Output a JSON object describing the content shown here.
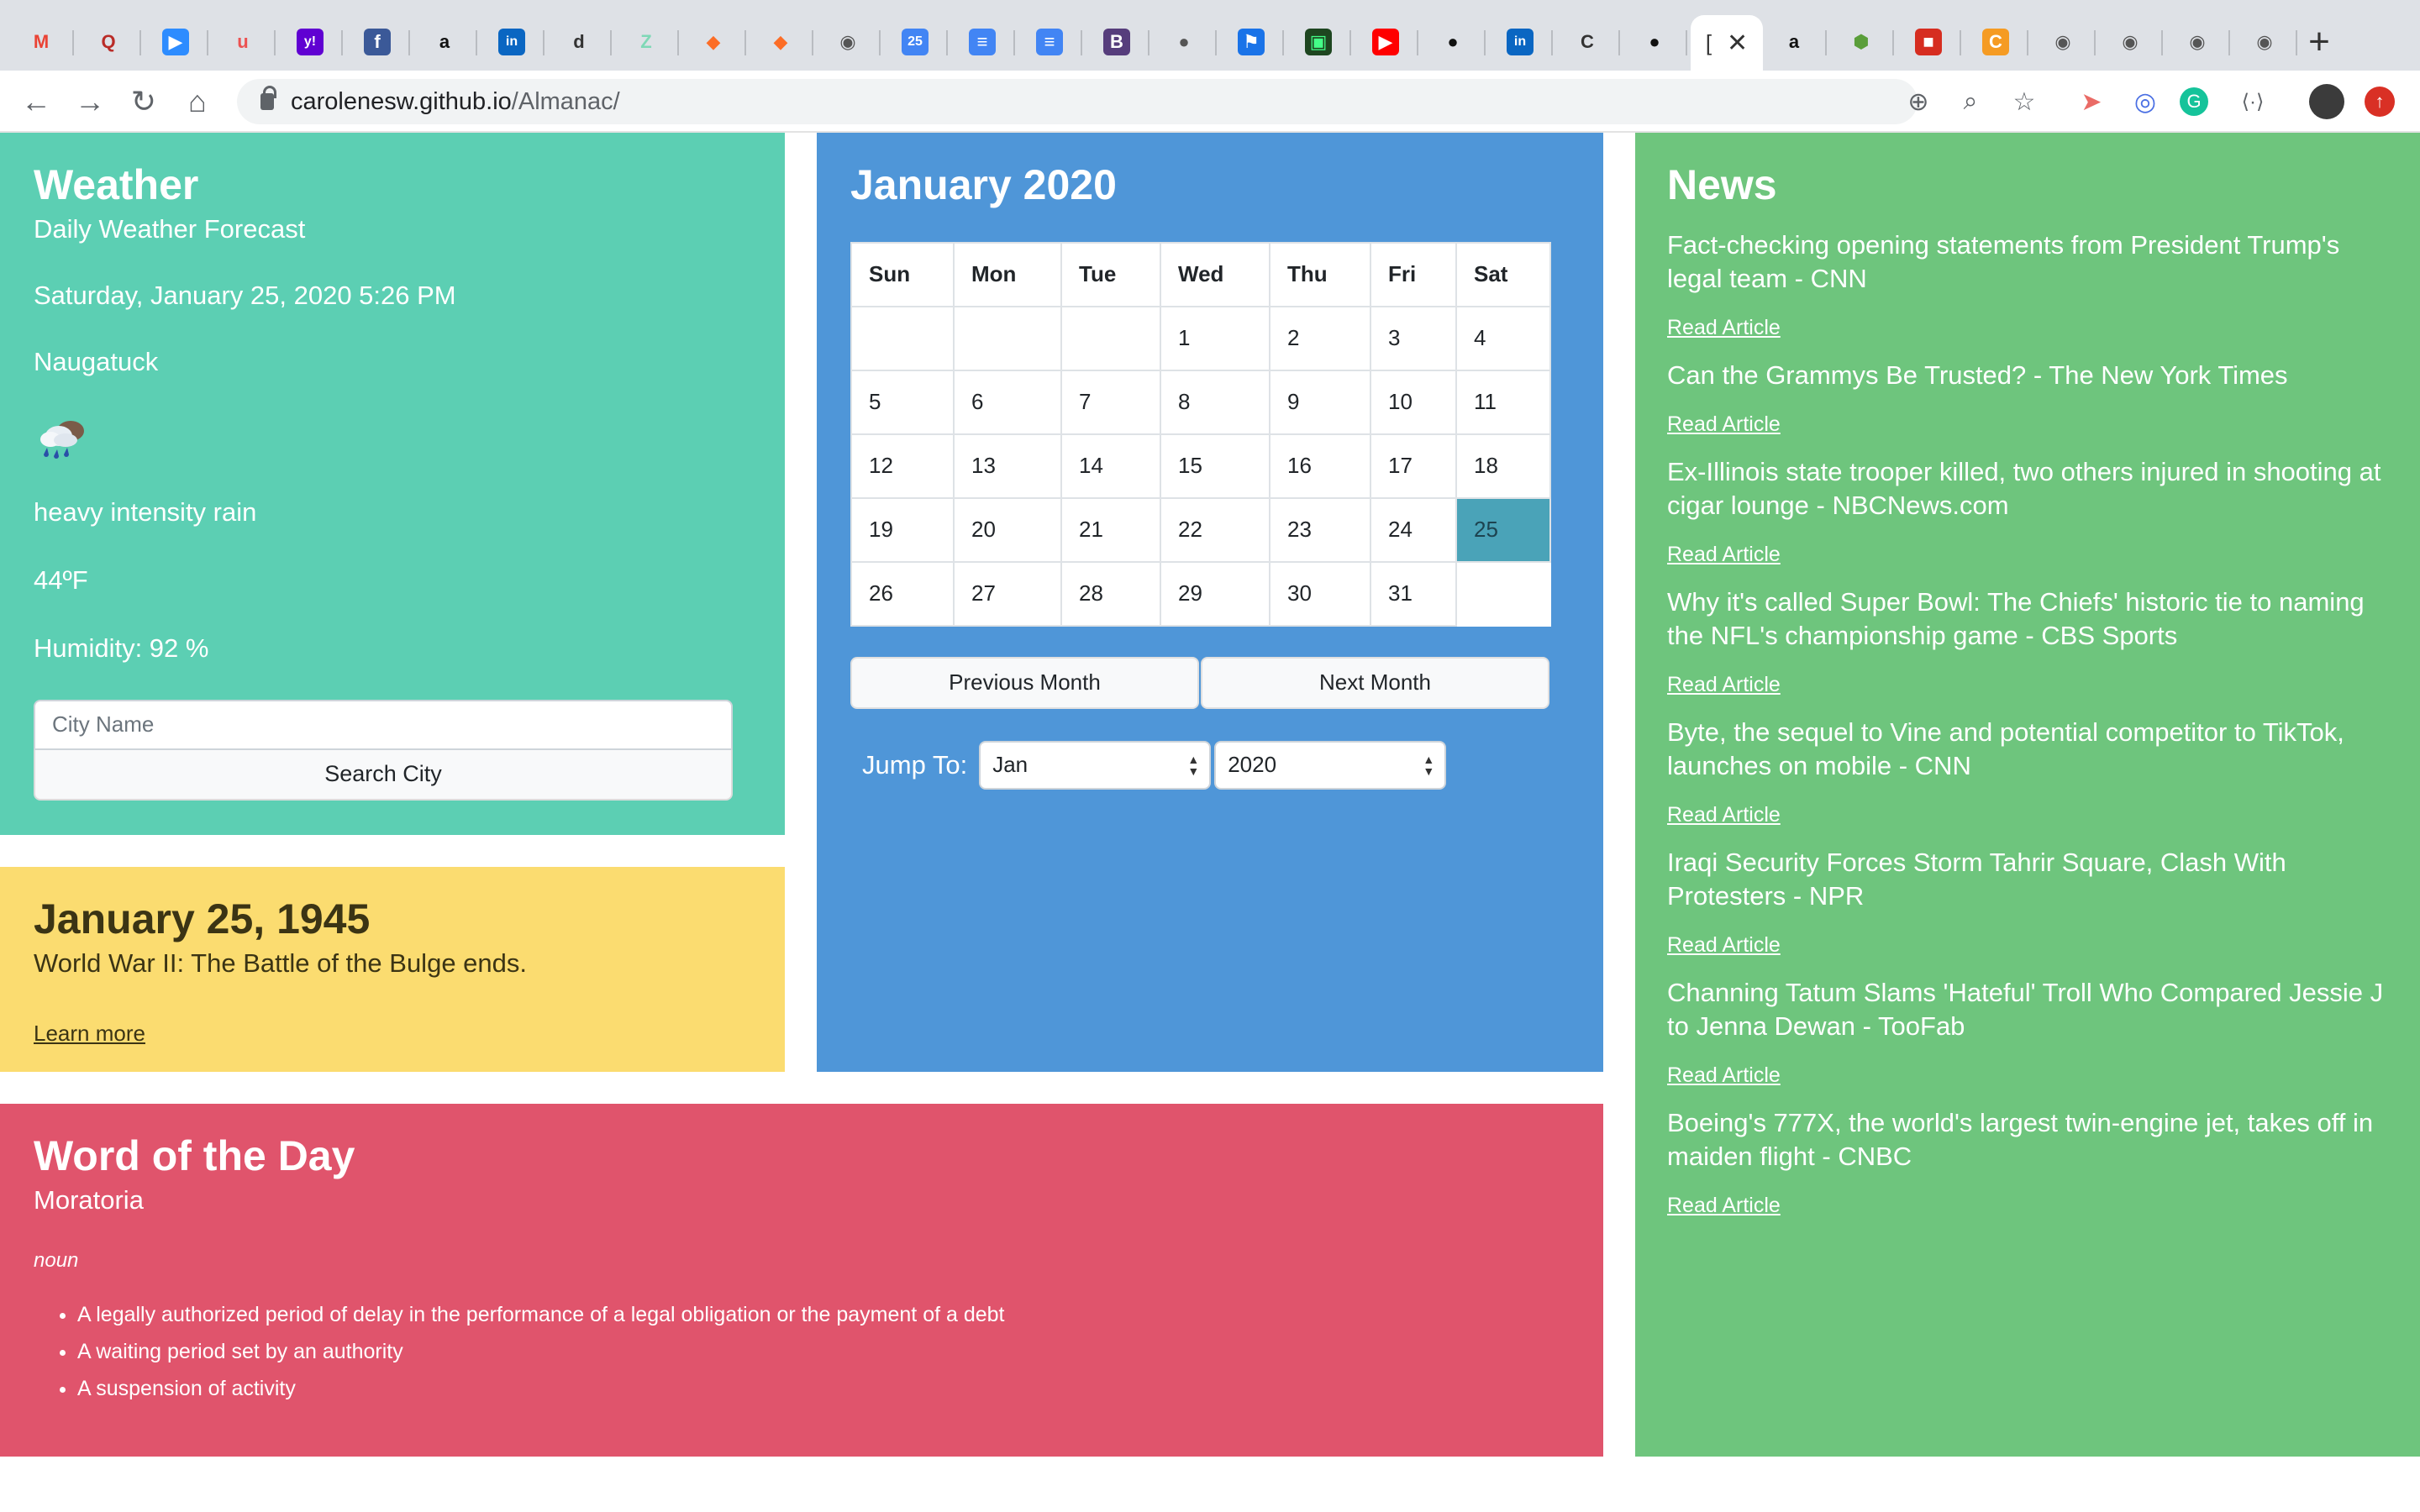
{
  "browser": {
    "tabs": [
      {
        "icon": "gmail-icon",
        "glyph": "M",
        "color": "#ea4335",
        "bg": "transparent"
      },
      {
        "icon": "quora-icon",
        "glyph": "Q",
        "color": "#b92b27",
        "bg": "transparent"
      },
      {
        "icon": "zoom-icon",
        "glyph": "▶",
        "color": "#ffffff",
        "bg": "#2d8cff"
      },
      {
        "icon": "udemy-icon",
        "glyph": "u",
        "color": "#ec5252",
        "bg": "transparent"
      },
      {
        "icon": "yahoo-icon",
        "glyph": "y!",
        "color": "#ffffff",
        "bg": "#6001d2"
      },
      {
        "icon": "facebook-icon",
        "glyph": "f",
        "color": "#ffffff",
        "bg": "#3b5998"
      },
      {
        "icon": "amazon-icon",
        "glyph": "a",
        "color": "#111111",
        "bg": "transparent"
      },
      {
        "icon": "linkedin-icon",
        "glyph": "in",
        "color": "#ffffff",
        "bg": "#0a66c2"
      },
      {
        "icon": "doc-site-icon",
        "glyph": "d",
        "color": "#333333",
        "bg": "transparent"
      },
      {
        "icon": "zeplin-icon",
        "glyph": "Z",
        "color": "#7fd8b6",
        "bg": "transparent"
      },
      {
        "icon": "gitlab-icon",
        "glyph": "◆",
        "color": "#fc6d26",
        "bg": "transparent"
      },
      {
        "icon": "gitlab-icon",
        "glyph": "◆",
        "color": "#fc6d26",
        "bg": "transparent"
      },
      {
        "icon": "globe-icon",
        "glyph": "◉",
        "color": "#555555",
        "bg": "transparent"
      },
      {
        "icon": "calendar-icon",
        "glyph": "25",
        "color": "#ffffff",
        "bg": "#4285f4"
      },
      {
        "icon": "docs-icon",
        "glyph": "≡",
        "color": "#ffffff",
        "bg": "#4285f4"
      },
      {
        "icon": "docs-icon",
        "glyph": "≡",
        "color": "#ffffff",
        "bg": "#4285f4"
      },
      {
        "icon": "bootstrap-icon",
        "glyph": "B",
        "color": "#ffffff",
        "bg": "#563d7c"
      },
      {
        "icon": "apple-icon",
        "glyph": "●",
        "color": "#555555",
        "bg": "transparent"
      },
      {
        "icon": "flag-icon",
        "glyph": "⚑",
        "color": "#ffffff",
        "bg": "#1a73e8"
      },
      {
        "icon": "terminal-icon",
        "glyph": "▣",
        "color": "#44ff88",
        "bg": "#1e4620"
      },
      {
        "icon": "youtube-icon",
        "glyph": "▶",
        "color": "#ffffff",
        "bg": "#ff0000"
      },
      {
        "icon": "github-icon",
        "glyph": "●",
        "color": "#111111",
        "bg": "transparent"
      },
      {
        "icon": "linkedin-icon",
        "glyph": "in",
        "color": "#ffffff",
        "bg": "#0a66c2"
      },
      {
        "icon": "c-site-icon",
        "glyph": "C",
        "color": "#333333",
        "bg": "transparent"
      },
      {
        "icon": "github-icon",
        "glyph": "●",
        "color": "#111111",
        "bg": "transparent"
      },
      {
        "icon": "amazon-icon",
        "glyph": "a",
        "color": "#111111",
        "bg": "transparent"
      },
      {
        "icon": "node-icon",
        "glyph": "⬢",
        "color": "#5a9e3a",
        "bg": "transparent"
      },
      {
        "icon": "red-box-icon",
        "glyph": "■",
        "color": "#ffffff",
        "bg": "#d62d20"
      },
      {
        "icon": "orange-circle-icon",
        "glyph": "C",
        "color": "#ffffff",
        "bg": "#f59b23"
      },
      {
        "icon": "globe-icon",
        "glyph": "◉",
        "color": "#555555",
        "bg": "transparent"
      },
      {
        "icon": "globe-icon",
        "glyph": "◉",
        "color": "#555555",
        "bg": "transparent"
      },
      {
        "icon": "globe-icon",
        "glyph": "◉",
        "color": "#555555",
        "bg": "transparent"
      },
      {
        "icon": "globe-icon",
        "glyph": "◉",
        "color": "#555555",
        "bg": "transparent"
      }
    ],
    "active_tab_glyph": "[",
    "close_glyph": "✕",
    "new_tab_glyph": "+",
    "url_host": "carolenesw.github.io",
    "url_path": "/Almanac/"
  },
  "weather": {
    "title": "Weather",
    "subtitle": "Daily Weather Forecast",
    "datetime": "Saturday, January 25, 2020 5:26 PM",
    "city": "Naugatuck",
    "icon": "rain-cloud-icon",
    "description": "heavy intensity rain",
    "temperature": "44ºF",
    "humidity": "Humidity: 92 %",
    "input_placeholder": "City Name",
    "search_label": "Search City"
  },
  "calendar": {
    "title": "January 2020",
    "weekdays": [
      "Sun",
      "Mon",
      "Tue",
      "Wed",
      "Thu",
      "Fri",
      "Sat"
    ],
    "weeks": [
      [
        "",
        "",
        "",
        "1",
        "2",
        "3",
        "4"
      ],
      [
        "5",
        "6",
        "7",
        "8",
        "9",
        "10",
        "11"
      ],
      [
        "12",
        "13",
        "14",
        "15",
        "16",
        "17",
        "18"
      ],
      [
        "19",
        "20",
        "21",
        "22",
        "23",
        "24",
        "25"
      ],
      [
        "26",
        "27",
        "28",
        "29",
        "30",
        "31",
        ""
      ]
    ],
    "today": "25",
    "prev_label": "Previous Month",
    "next_label": "Next Month",
    "jump_label": "Jump To:",
    "month_value": "Jan",
    "year_value": "2020",
    "highlight_color": "#4aa3b8"
  },
  "history": {
    "title": "January 25, 1945",
    "event": "World War II: The Battle of the Bulge ends.",
    "link_label": "Learn more"
  },
  "word": {
    "title": "Word of the Day",
    "word": "Moratoria",
    "part_of_speech": "noun",
    "definitions": [
      "A legally authorized period of delay in the performance of a legal obligation or the payment of a debt",
      "A waiting period set by an authority",
      "A suspension of activity"
    ]
  },
  "news": {
    "title": "News",
    "link_label": "Read Article",
    "items": [
      "Fact-checking opening statements from President Trump's legal team - CNN",
      "Can the Grammys Be Trusted? - The New York Times",
      "Ex-Illinois state trooper killed, two others injured in shooting at cigar lounge - NBCNews.com",
      "Why it's called Super Bowl: The Chiefs' historic tie to naming the NFL's championship game - CBS Sports",
      "Byte, the sequel to Vine and potential competitor to TikTok, launches on mobile - CNN",
      "Iraqi Security Forces Storm Tahrir Square, Clash With Protesters - NPR",
      "Channing Tatum Slams 'Hateful' Troll Who Compared Jessie J to Jenna Dewan - TooFab",
      "Boeing's 777X, the world's largest twin-engine jet, takes off in maiden flight - CNBC"
    ]
  },
  "colors": {
    "weather_bg": "#5ccfb3",
    "calendar_bg": "#4f96d8",
    "news_bg": "#6ec57d",
    "history_bg": "#fbdc70",
    "word_bg": "#e0546c"
  }
}
